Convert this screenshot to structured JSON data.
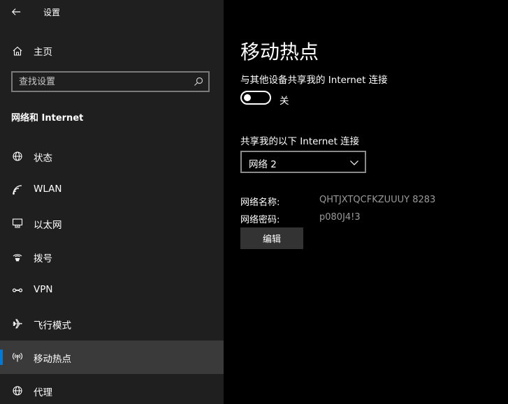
{
  "window": {
    "title": "设置"
  },
  "sidebar": {
    "home_label": "主页",
    "search_placeholder": "查找设置",
    "section_heading": "网络和 Internet",
    "items": [
      {
        "label": "状态",
        "icon": "globe-icon"
      },
      {
        "label": "WLAN",
        "icon": "wifi-icon"
      },
      {
        "label": "以太网",
        "icon": "ethernet-icon"
      },
      {
        "label": "拨号",
        "icon": "dialup-icon"
      },
      {
        "label": "VPN",
        "icon": "vpn-icon"
      },
      {
        "label": "飞行模式",
        "icon": "airplane-icon"
      },
      {
        "label": "移动热点",
        "icon": "hotspot-icon",
        "selected": true
      },
      {
        "label": "代理",
        "icon": "globe-icon"
      }
    ]
  },
  "main": {
    "page_title": "移动热点",
    "share_label": "与其他设备共享我的 Internet 连接",
    "toggle": {
      "on": false,
      "state_label": "关"
    },
    "share_from_label": "共享我的以下 Internet 连接",
    "share_from_value": "网络 2",
    "network_name_label": "网络名称:",
    "network_name_value": "QHTJXTQCFKZUUUY 8283",
    "network_password_label": "网络密码:",
    "network_password_value": "p080J4!3",
    "edit_label": "编辑"
  },
  "colors": {
    "sidebar_bg": "#1f1f1f",
    "main_bg": "#000000",
    "accent": "#0078d7",
    "selected_bg": "#3a3a3a",
    "secondary_text": "#9a9a9a"
  }
}
